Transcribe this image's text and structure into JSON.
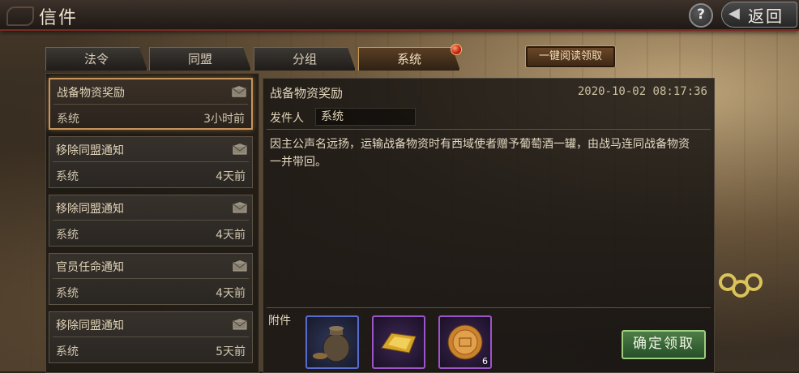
{
  "window": {
    "title": "信件"
  },
  "header": {
    "help_label": "?",
    "back_label": "返回"
  },
  "tabs": [
    {
      "label": "法令",
      "active": false
    },
    {
      "label": "同盟",
      "active": false
    },
    {
      "label": "分组",
      "active": false
    },
    {
      "label": "系统",
      "active": true,
      "has_notification": true
    }
  ],
  "toolbar": {
    "read_all_label": "一键阅读领取"
  },
  "mail_list": [
    {
      "title": "战备物资奖励",
      "sender": "系统",
      "time": "3小时前",
      "selected": true
    },
    {
      "title": "移除同盟通知",
      "sender": "系统",
      "time": "4天前",
      "selected": false
    },
    {
      "title": "移除同盟通知",
      "sender": "系统",
      "time": "4天前",
      "selected": false
    },
    {
      "title": "官员任命通知",
      "sender": "系统",
      "time": "4天前",
      "selected": false
    },
    {
      "title": "移除同盟通知",
      "sender": "系统",
      "time": "5天前",
      "selected": false
    }
  ],
  "detail": {
    "title": "战备物资奖励",
    "date": "2020-10-02 08:17:36",
    "sender_label": "发件人",
    "sender": "系统",
    "body": "因主公声名远扬，运输战备物资时有西域使者赠予葡萄酒一罐，由战马连同战备物资一并带回。",
    "attachments_label": "附件",
    "attachments": [
      {
        "icon": "wine-jar-icon",
        "count": ""
      },
      {
        "icon": "gold-ingot-icon",
        "count": ""
      },
      {
        "icon": "mooncake-icon",
        "count": "6"
      }
    ],
    "claim_label": "确定领取"
  },
  "colors": {
    "accent": "#c6955a",
    "claim": "#4d7d45",
    "notification": "#c0200c"
  }
}
